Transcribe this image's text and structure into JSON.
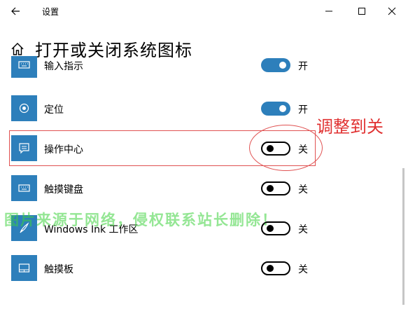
{
  "window": {
    "title": "设置"
  },
  "page": {
    "title": "打开或关闭系统图标"
  },
  "colors": {
    "accent": "#2d7fbb",
    "annotation": "#e03030",
    "watermark": "#3cd23c"
  },
  "items": [
    {
      "label": "输入指示",
      "state": "开",
      "on": true,
      "icon": "keyboard-icon"
    },
    {
      "label": "定位",
      "state": "开",
      "on": true,
      "icon": "location-icon"
    },
    {
      "label": "操作中心",
      "state": "关",
      "on": false,
      "icon": "action-center-icon"
    },
    {
      "label": "触摸键盘",
      "state": "关",
      "on": false,
      "icon": "touch-keyboard-icon"
    },
    {
      "label": "Windows Ink 工作区",
      "state": "关",
      "on": false,
      "icon": "pen-icon"
    },
    {
      "label": "触摸板",
      "state": "关",
      "on": false,
      "icon": "touchpad-icon"
    }
  ],
  "annotation": {
    "text": "调整到关"
  },
  "watermark": {
    "text": "图片来源于网络，侵权联系站长删除！"
  }
}
